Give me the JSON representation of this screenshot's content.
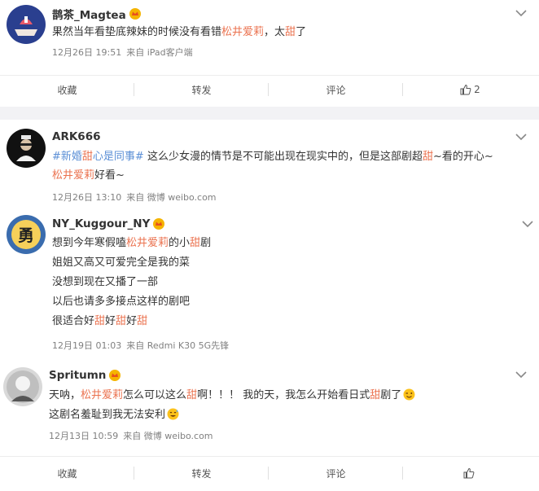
{
  "posts": [
    {
      "username": "鹊茶_Magtea",
      "text": [
        "果然当年看垫底辣妹的时候没有看错",
        "松井爱莉",
        "，太",
        "甜",
        "了"
      ],
      "date": "12月26日 19:51",
      "source": "来自 iPad客户端"
    },
    {
      "username": "ARK666",
      "line1": [
        "#新婚",
        "甜",
        "心是同事#",
        " 这么少女漫的情节是不可能出现在现实中的，但是这部剧超",
        "甜",
        "~看的开心~"
      ],
      "line2": [
        "松井爱莉",
        "好看~"
      ],
      "date": "12月26日 13:10",
      "source": "来自 微博 weibo.com"
    },
    {
      "username": "NY_Kuggour_NY",
      "lines": [
        [
          "想到今年寒假嗑",
          "松井爱莉",
          "的小",
          "甜",
          "剧"
        ],
        [
          "姐姐又高又可爱完全是我的菜"
        ],
        [
          "没想到现在又播了一部"
        ],
        [
          "以后也请多多接点这样的剧吧"
        ],
        [
          "很适合好",
          "甜",
          "好",
          "甜",
          "好",
          "甜"
        ]
      ],
      "date": "12月19日 01:03",
      "source": "来自 Redmi K30 5G先锋"
    },
    {
      "username": "Spritumn",
      "line1": [
        "天呐，",
        "松井爱莉",
        "怎么可以这么",
        "甜",
        "啊！！！ 我的天，我怎么开始看日式",
        "甜",
        "剧了"
      ],
      "line2": [
        "这剧名羞耻到我无法安利"
      ],
      "date": "12月13日 10:59",
      "source": "来自 微博 weibo.com"
    }
  ],
  "actions_top": {
    "collect": "收藏",
    "forward": "转发",
    "comment": "评论",
    "like_count": "2"
  },
  "actions_bottom": {
    "collect": "收藏",
    "forward": "转发",
    "comment": "评论",
    "like_count": ""
  },
  "icons": {
    "crown": "vip-crown-icon",
    "chevron": "chevron-down-icon",
    "like": "thumb-up-icon",
    "emoji_wink": "wink-emoji-icon",
    "emoji_sweat": "sweat-smile-emoji-icon"
  },
  "colors": {
    "highlight": "#eb7350",
    "tag": "#5b8fd6",
    "meta": "#808080",
    "gap": "#f2f2f5"
  }
}
